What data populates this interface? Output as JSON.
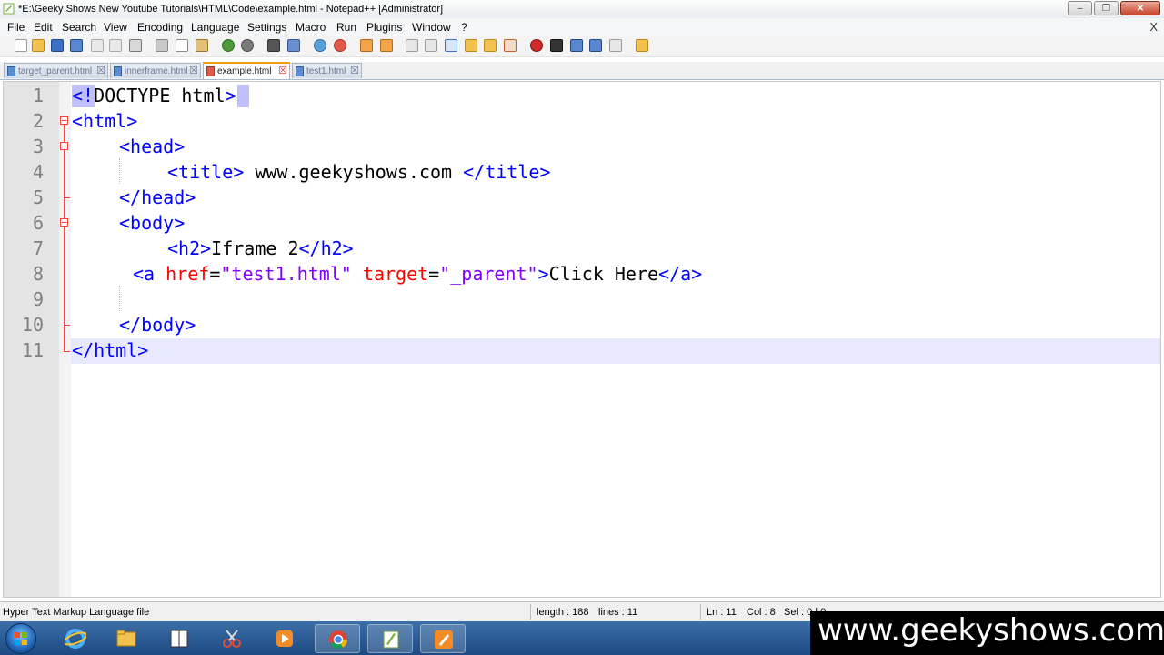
{
  "window": {
    "title": "*E:\\Geeky Shows New Youtube Tutorials\\HTML\\Code\\example.html - Notepad++ [Administrator]"
  },
  "menu": {
    "items": [
      "File",
      "Edit",
      "Search",
      "View",
      "Encoding",
      "Language",
      "Settings",
      "Macro",
      "Run",
      "Plugins",
      "Window",
      "?"
    ],
    "close_glyph": "X"
  },
  "tabs": [
    {
      "label": "target_parent.html",
      "active": false
    },
    {
      "label": "innerframe.html",
      "active": false
    },
    {
      "label": "example.html",
      "active": true
    },
    {
      "label": "test1.html",
      "active": false
    }
  ],
  "editor": {
    "line_numbers": [
      "1",
      "2",
      "3",
      "4",
      "5",
      "6",
      "7",
      "8",
      "9",
      "10",
      "11"
    ],
    "current_line": 11,
    "lines": {
      "l1": {
        "a": "<!",
        "b": "DOCTYPE html",
        "c": ">"
      },
      "l2": {
        "a": "<html>"
      },
      "l3": {
        "a": "<head>"
      },
      "l4": {
        "a": "<title>",
        "b": " www.geekyshows.com ",
        "c": "</title>"
      },
      "l5": {
        "a": "</head>"
      },
      "l6": {
        "a": "<body>"
      },
      "l7": {
        "a": "<h2>",
        "b": "Iframe 2",
        "c": "</h2>"
      },
      "l8": {
        "a": "<a",
        "b": " href",
        "c": "=",
        "d": "\"test1.html\"",
        "e": " target",
        "f": "=",
        "g": "\"_parent\"",
        "h": ">",
        "i": "Click Here",
        "j": "</a>"
      },
      "l10": {
        "a": "</body>"
      },
      "l11": {
        "a": "</html>"
      }
    }
  },
  "status": {
    "file_type": "Hyper Text Markup Language file",
    "length": "length : 188",
    "lines": "lines : 11",
    "ln": "Ln : 11",
    "col": "Col : 8",
    "sel": "Sel : 0 | 0"
  },
  "watermark": {
    "text": "www.geekyshows.com"
  },
  "colors": {
    "tag": "#0000ff",
    "attribute": "#ff0000",
    "string": "#8000ff",
    "active_tab_accent": "#f39c12",
    "taskbar": "#1d4a82"
  }
}
